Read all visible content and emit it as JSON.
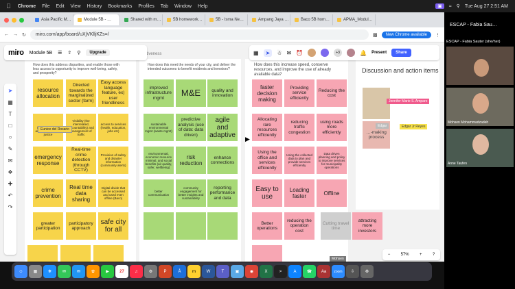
{
  "mac": {
    "app": "Chrome",
    "menus": [
      "File",
      "Edit",
      "View",
      "History",
      "Bookmarks",
      "Profiles",
      "Tab",
      "Window",
      "Help"
    ],
    "clock": "Tue Aug 27  2:51 AM"
  },
  "tabs": [
    "Asia Pacific M…",
    "Module 5B - …",
    "Shared with m…",
    "5B homework…",
    "5B - Isma Ne…",
    "Ampang Jaya …",
    "Baco 5B hom…",
    "APMA_Modul…"
  ],
  "url": "miro.com/app/board/uXjVKlljKZs=/",
  "new_chrome": "New Chrome available",
  "miro": {
    "logo": "miro",
    "board": "Module 5B",
    "upgrade": "Upgrade",
    "present": "Present",
    "share": "Share",
    "count": "+3",
    "zoom": "57%"
  },
  "columns": {
    "c1_q": "How does this address disparities, and enable those with less access to opportunity to improve well-being, safety, and prosperity?",
    "c2_head": "ectiveness",
    "c2_q": "How does this meet the needs of your city, and deliver the intended outcomes to benefit residents and investors?",
    "c3_q": "How does this increase speed, conserve resources, and improve the use of already available data?",
    "c4_title": "Discussion and action items"
  },
  "notes": {
    "y1": "resource allocation",
    "y2": "Directed towards the marginalized sector (farm)",
    "y3": "Easy access language feature, ex) user friendliness",
    "y4": "(public services, and environmental justice",
    "y5": "Visibility (the interrelated, accountability) and management of traffic",
    "y6": "access to services (health, education, jobs etc)",
    "y7": "emergency response",
    "y8": "Real-time crime detection (through CCTV)",
    "y9": "Provision of safety and disaster information (community alerts)",
    "y10": "crime prevention",
    "y11": "Real time data sharing",
    "y12": "Digital divide that can be accessed and used even offline (Baco)",
    "y13": "greater participation",
    "y14": "participatory approach",
    "y15": "safe city for all",
    "g1": "improved infrastructure mgmt",
    "g2": "M&E",
    "g3": "quality and innovation",
    "g4": "sustainable environmental mgmt (waste mgmt)",
    "g5": "predictive analysis (use of data: data driven)",
    "g6": "agile and adaptive",
    "g7": "environmental, economic resource minimal, and social benefits (air quality, safer, wellbeing)",
    "g8": "risk reduction",
    "g9": "enhance connections",
    "g10": "better communication",
    "g11": "community engagement for better insights and sustainability",
    "g12": "reporting performance and data",
    "p1": "faster decision making",
    "p2": "Providing service efficiently",
    "p3": "Reducing the cost",
    "p4": "Allocating rare resources efficiently",
    "p5": "reducing traffic congestion",
    "p6": "using roads more efficiently",
    "p7": "Using the office and services efficiently",
    "p8": "Using the collected data to plan and provide services efficiently",
    "p9": "Data driven planning and policy to improve services for municipality operations",
    "p10": "Easy to use",
    "p11": "Loading faster",
    "p12": "Offline",
    "p13": "Better operations",
    "p14": "reducing the operation cost",
    "p15": "Cutting travel time",
    "p16": "attracting more investors",
    "gr1": "…the decision-making process",
    "gr2": "…-making process"
  },
  "cursors": {
    "c1": "Eunice del Rosario",
    "c2": "Jennifer Marie S. Amparo",
    "c3": "Edgar",
    "c4": "Edgar Jr Reyes",
    "c5": "Mohsen"
  },
  "side": {
    "title": "ESCAP - Fabia Sau…",
    "sub": "ESCAP - Fabia Sauter (she/her)",
    "v2": "Mohsen Mohammadzadeh",
    "v3": "Anne Taufen"
  },
  "dock_badge": "27"
}
